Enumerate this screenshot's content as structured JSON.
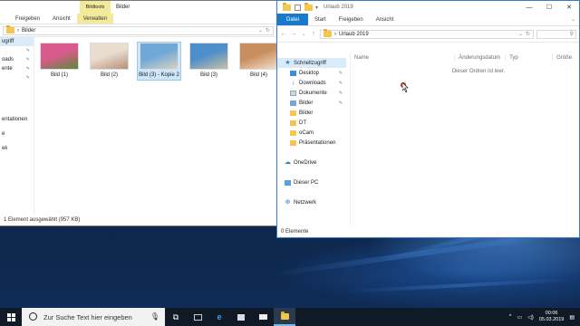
{
  "colors": {
    "accent": "#1979ca",
    "ctx_tab": "#f3e99a",
    "taskbar": "#101a26"
  },
  "left_window": {
    "ctx_header": "Bildtools",
    "title": "Bilder",
    "tabs": [
      "Freigeben",
      "Ansicht",
      "Verwalten"
    ],
    "address": "Bilder",
    "nav_items": [
      {
        "label": "ugriff",
        "pinned": false
      },
      {
        "label": "",
        "pinned": true
      },
      {
        "label": "oads",
        "pinned": true
      },
      {
        "label": "ente",
        "pinned": true
      },
      {
        "label": "",
        "pinned": true
      }
    ],
    "nav_lower": [
      "",
      "entationen",
      "",
      "e",
      "",
      "ek"
    ],
    "thumbnails": [
      {
        "label": "Bild (1)",
        "selected": false,
        "colors": [
          "#d95a8c",
          "#5b8a3a"
        ]
      },
      {
        "label": "Bild (2)",
        "selected": false,
        "colors": [
          "#e9ddd0",
          "#b88e77"
        ]
      },
      {
        "label": "Bild (3) - Kopie 2",
        "selected": true,
        "colors": [
          "#6fa8d6",
          "#d8d3c2"
        ]
      },
      {
        "label": "Bild (3)",
        "selected": false,
        "colors": [
          "#4f8fc9",
          "#c9c0a8"
        ]
      },
      {
        "label": "Bild (4)",
        "selected": false,
        "colors": [
          "#c98e5e",
          "#f2e1cf"
        ]
      }
    ],
    "status": "1 Element ausgewählt (957 KB)"
  },
  "right_window": {
    "title": "Urlaub 2019",
    "tabs": [
      "Datei",
      "Start",
      "Freigeben",
      "Ansicht"
    ],
    "address": "Urlaub 2019",
    "nav": [
      {
        "label": "Schnellzugriff",
        "icon": "star-icon",
        "selected": true,
        "pinned": false,
        "sub": false
      },
      {
        "label": "Desktop",
        "icon": "desktop-icon",
        "selected": false,
        "pinned": true,
        "sub": true
      },
      {
        "label": "Downloads",
        "icon": "download-icon",
        "selected": false,
        "pinned": true,
        "sub": true
      },
      {
        "label": "Dokumente",
        "icon": "documents-icon",
        "selected": false,
        "pinned": true,
        "sub": true
      },
      {
        "label": "Bilder",
        "icon": "pictures-icon",
        "selected": false,
        "pinned": true,
        "sub": true
      },
      {
        "label": "Bilder",
        "icon": "folder-icon",
        "selected": false,
        "pinned": false,
        "sub": true
      },
      {
        "label": "DT",
        "icon": "folder-icon",
        "selected": false,
        "pinned": false,
        "sub": true
      },
      {
        "label": "oCam",
        "icon": "folder-icon",
        "selected": false,
        "pinned": false,
        "sub": true
      },
      {
        "label": "Präsentationen",
        "icon": "folder-icon",
        "selected": false,
        "pinned": false,
        "sub": true
      },
      {
        "label": "",
        "icon": "",
        "selected": false,
        "pinned": false,
        "sub": false
      },
      {
        "label": "OneDrive",
        "icon": "cloud-icon",
        "selected": false,
        "pinned": false,
        "sub": false
      },
      {
        "label": "",
        "icon": "",
        "selected": false,
        "pinned": false,
        "sub": false
      },
      {
        "label": "Dieser PC",
        "icon": "computer-icon",
        "selected": false,
        "pinned": false,
        "sub": false
      },
      {
        "label": "",
        "icon": "",
        "selected": false,
        "pinned": false,
        "sub": false
      },
      {
        "label": "Netzwerk",
        "icon": "network-icon",
        "selected": false,
        "pinned": false,
        "sub": false
      }
    ],
    "columns": [
      "Name",
      "Änderungsdatum",
      "Typ",
      "Größe"
    ],
    "empty_text": "Dieser Ordner ist leer.",
    "status": "0 Elemente"
  },
  "taskbar": {
    "search_placeholder": "Zur Suche Text hier eingeben",
    "time": "00:06",
    "date": "05.03.2019"
  }
}
